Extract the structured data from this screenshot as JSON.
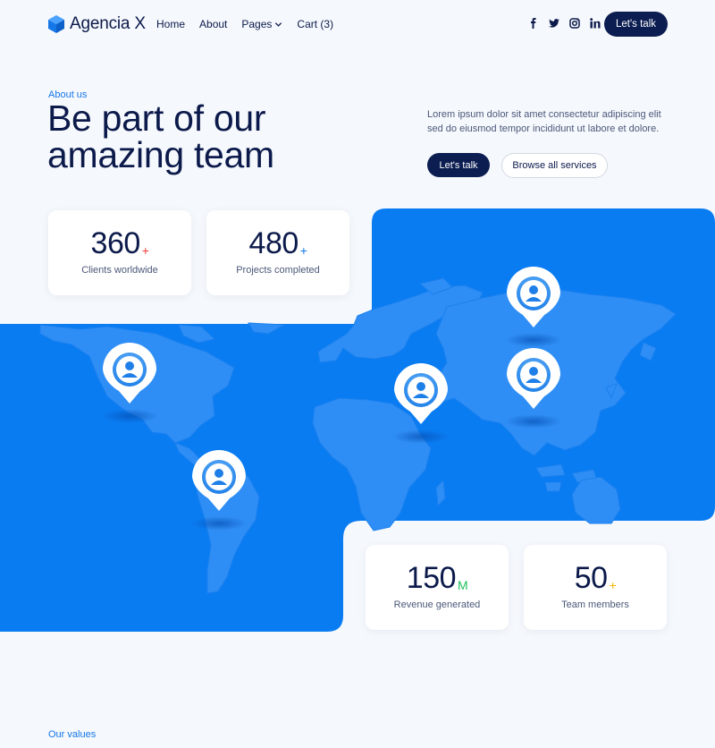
{
  "brand": {
    "name": "Agencia X",
    "color": "#1677e8",
    "logo_icon": "cube-icon"
  },
  "nav": {
    "items": [
      {
        "label": "Home"
      },
      {
        "label": "About"
      },
      {
        "label": "Pages",
        "icon": "chevron-down-icon"
      },
      {
        "label": "Cart (3)"
      }
    ],
    "socials": [
      "facebook-icon",
      "twitter-icon",
      "instagram-icon",
      "linkedin-icon"
    ],
    "cta_label": "Let's talk"
  },
  "hero": {
    "eyebrow": "About us",
    "title": "Be part of our amazing team",
    "description": "Lorem ipsum dolor sit amet consectetur adipiscing elit sed do eiusmod tempor incididunt ut labore et dolore.",
    "primary_button": "Let's talk",
    "secondary_button": "Browse all services"
  },
  "map": {
    "color": "#0a7cf2",
    "land_color": "#2f8ef5",
    "pin_icon": "user-pin-icon",
    "pin_count": 5
  },
  "stats": [
    {
      "value": "360",
      "suffix": "+",
      "suffix_color": "#ef3b3b",
      "label": "Clients worldwide"
    },
    {
      "value": "480",
      "suffix": "+",
      "suffix_color": "#1677e8",
      "label": "Projects completed"
    },
    {
      "value": "150",
      "suffix": "M",
      "suffix_color": "#1fbf5a",
      "label": "Revenue generated"
    },
    {
      "value": "50",
      "suffix": "+",
      "suffix_color": "#f2b705",
      "label": "Team members"
    }
  ],
  "values_eyebrow": "Our values"
}
